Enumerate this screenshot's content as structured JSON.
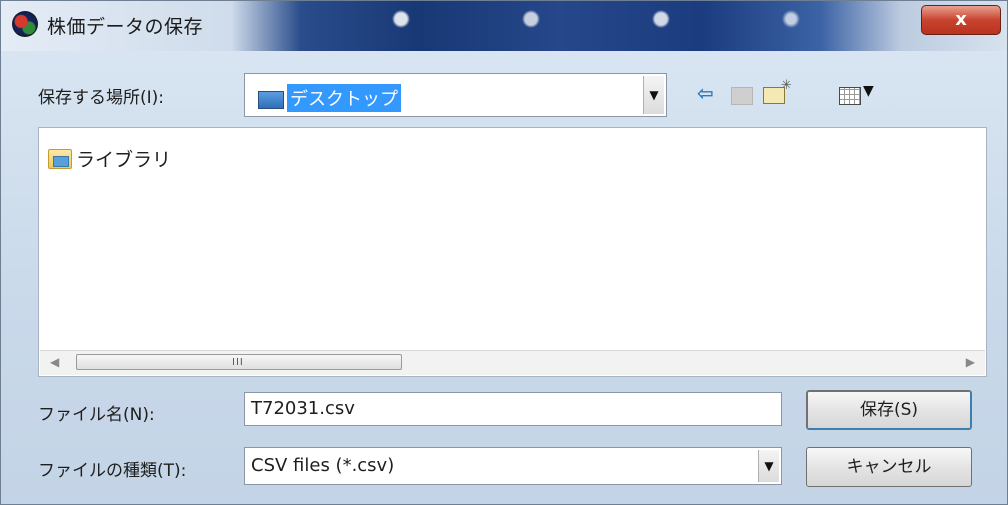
{
  "window": {
    "title": "株価データの保存",
    "close_glyph": "x"
  },
  "location": {
    "label": "保存する場所(I):",
    "value": "デスクトップ"
  },
  "toolbar": {
    "back_icon": "back-arrow-icon",
    "up_icon": "up-folder-icon",
    "new_folder_icon": "new-folder-icon",
    "view_icon": "view-menu-icon"
  },
  "file_list": {
    "items": [
      {
        "label": "ライブラリ",
        "icon": "library-folder-icon"
      }
    ]
  },
  "scrollbar": {
    "grip": "III"
  },
  "filename": {
    "label": "ファイル名(N):",
    "value": "T72031.csv"
  },
  "filetype": {
    "label": "ファイルの種類(T):",
    "value": "CSV files (*.csv)"
  },
  "buttons": {
    "save": "保存(S)",
    "cancel": "キャンセル"
  },
  "colors": {
    "selection": "#3399ff",
    "titlebar_dark": "#1b3c7e",
    "close_red": "#c9442f"
  }
}
